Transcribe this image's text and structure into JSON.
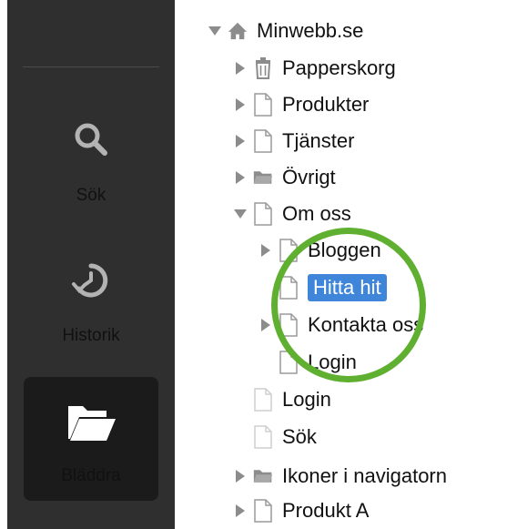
{
  "sidebar": {
    "buttons": [
      {
        "label": "Sök",
        "icon": "search-icon",
        "active": false
      },
      {
        "label": "Historik",
        "icon": "history-icon",
        "active": false
      },
      {
        "label": "Bläddra",
        "icon": "folder-open-icon",
        "active": true
      }
    ]
  },
  "tree": {
    "rows": [
      {
        "label": "Minwebb.se",
        "arrow": "down",
        "icon": "home-icon",
        "level": 0
      },
      {
        "label": "Papperskorg",
        "arrow": "right",
        "icon": "trash-icon",
        "level": 1
      },
      {
        "label": "Produkter",
        "arrow": "right",
        "icon": "page-icon",
        "level": 1
      },
      {
        "label": "Tjänster",
        "arrow": "right",
        "icon": "page-icon",
        "level": 1
      },
      {
        "label": "Övrigt",
        "arrow": "right",
        "icon": "folder-icon",
        "level": 1
      },
      {
        "label": "Om oss",
        "arrow": "down",
        "icon": "page-icon",
        "level": 1
      },
      {
        "label": "Bloggen",
        "arrow": "right",
        "icon": "page-icon",
        "level": 2
      },
      {
        "label": "Hitta hit",
        "arrow": "none",
        "icon": "page-icon",
        "level": 2,
        "selected": true
      },
      {
        "label": "Kontakta oss",
        "arrow": "right",
        "icon": "page-icon",
        "level": 2
      },
      {
        "label": "Login",
        "arrow": "none",
        "icon": "page-icon",
        "level": 2
      },
      {
        "label": "Login",
        "arrow": "none",
        "icon": "page-faded-icon",
        "level": 1
      },
      {
        "label": "Sök",
        "arrow": "none",
        "icon": "page-faded-icon",
        "level": 1
      },
      {
        "label": "Ikoner i navigatorn",
        "arrow": "right",
        "icon": "folder-icon",
        "level": 1
      },
      {
        "label": "Produkt A",
        "arrow": "right",
        "icon": "page-icon",
        "level": 1
      }
    ]
  },
  "colors": {
    "sidebar_bg": "#2f2f2f",
    "active_bg": "#1b1b1b",
    "selection": "#3f86db",
    "highlight_circle": "#5fb030"
  }
}
